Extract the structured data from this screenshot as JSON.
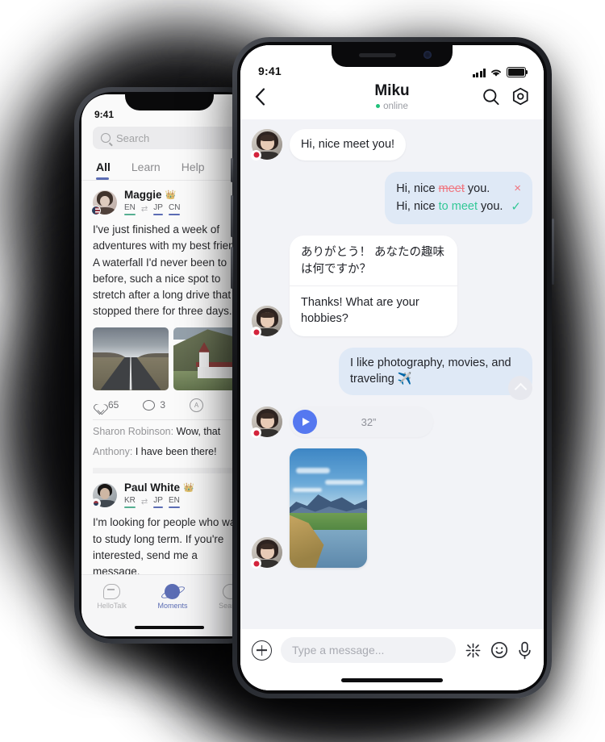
{
  "front_phone": {
    "status_bar": {
      "time": "9:41",
      "signal_icon": "signal-bars-icon",
      "wifi_icon": "wifi-icon",
      "battery_icon": "battery-icon"
    },
    "header": {
      "back_icon": "chevron-left-icon",
      "name": "Miku",
      "status": "online",
      "search_icon": "search-icon",
      "settings_icon": "settings-hexagon-icon"
    },
    "messages": [
      {
        "id": "m1",
        "side": "left",
        "type": "text",
        "text": "Hi, nice meet you!"
      },
      {
        "id": "m2",
        "side": "right",
        "type": "correction",
        "original_prefix": "Hi, nice ",
        "original_strike": "meet",
        "original_suffix": " you.",
        "corrected_prefix": "Hi, nice ",
        "corrected_highlight": "to meet",
        "corrected_suffix": " you.",
        "reject_mark": "×",
        "accept_mark": "✓"
      },
      {
        "id": "m3",
        "side": "left",
        "type": "translated",
        "source": "ありがとう！ あなたの趣味は何ですか？",
        "translation": "Thanks! What are your hobbies?"
      },
      {
        "id": "m4",
        "side": "right",
        "type": "text",
        "text": "I like photography, movies, and traveling ✈️"
      },
      {
        "id": "m5",
        "side": "left",
        "type": "voice",
        "duration": "32”",
        "play_icon": "play-icon"
      },
      {
        "id": "m6",
        "side": "left",
        "type": "photo",
        "alt": "landscape-photo-mountains-river"
      }
    ],
    "scroll_up_icon": "chevron-up-icon",
    "composer": {
      "add_icon": "plus-circle-icon",
      "placeholder": "Type a message...",
      "translate_icon": "sparkle-translate-icon",
      "emoji_icon": "emoji-smile-icon",
      "mic_icon": "microphone-icon"
    }
  },
  "back_phone": {
    "status_bar": {
      "time": "9:41"
    },
    "search": {
      "placeholder": "Search",
      "icon": "search-icon"
    },
    "tabs": [
      {
        "label": "All",
        "active": true
      },
      {
        "label": "Learn",
        "active": false
      },
      {
        "label": "Help",
        "active": false
      }
    ],
    "posts": [
      {
        "name": "Maggie",
        "badge": "👑",
        "flag": "us-flag-icon",
        "languages": [
          {
            "code": "EN",
            "color": "green"
          },
          {
            "code": "JP",
            "color": "blue"
          },
          {
            "code": "CN",
            "color": "blue"
          }
        ],
        "arrow": "⇄",
        "text": "I've just finished a week of adventures with my best friend. A waterfall I'd never been to before, such a nice spot to stretch after a long drive that I stopped there for three days.",
        "images": [
          "road-landscape-photo",
          "church-hillside-photo"
        ],
        "likes": "65",
        "comments": "3",
        "translate_icon": "translate-icon",
        "comment_list": [
          {
            "author": "Sharon Robinson:",
            "text": "Wow, that"
          },
          {
            "author": "Anthony:",
            "text": "I have been there!"
          }
        ]
      },
      {
        "name": "Paul White",
        "badge": "👑",
        "flag": "kr-flag-icon",
        "languages": [
          {
            "code": "KR",
            "color": "green"
          },
          {
            "code": "JP",
            "color": "blue"
          },
          {
            "code": "EN",
            "color": "blue"
          }
        ],
        "arrow": "⇄",
        "text": "I'm looking for people who want to study long term. If you're interested, send me a message."
      }
    ],
    "tabbar": [
      {
        "label": "HelloTalk",
        "icon": "chat-bubble-icon",
        "active": false
      },
      {
        "label": "Moments",
        "icon": "planet-icon",
        "active": true
      },
      {
        "label": "Search",
        "icon": "search-icon",
        "active": false
      }
    ]
  },
  "colors": {
    "accent_blue": "#4e6ef2",
    "bubble_blue": "#dfe9f6",
    "online_green": "#21c17a",
    "error_red": "#f0757f",
    "success_green": "#32c896",
    "play_blue": "#5578f0",
    "chat_bg": "#f2f3f7"
  }
}
